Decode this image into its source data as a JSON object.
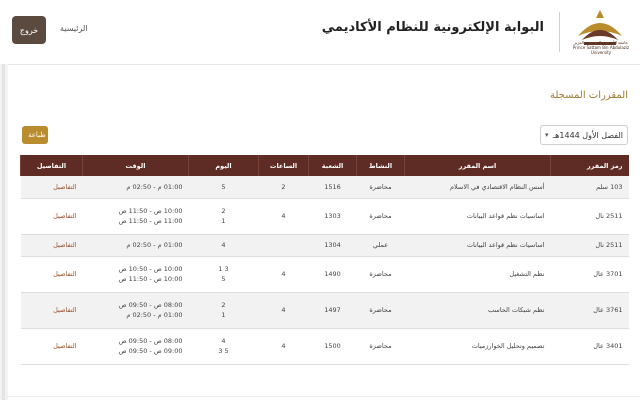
{
  "header": {
    "portal_title": "البوابة الإلكترونية للنظام الأكاديمي",
    "university_name_ar": "جامعة الأمير سطام بن عبدالعزيز",
    "university_name_en": "Prince Sattam Bin Abdulaziz University",
    "home_label": "الرئيسية",
    "logout_label": "خروج"
  },
  "page": {
    "section_title": "المقررات المسجلة",
    "semester_value": "الفصل الأول 1444هـ",
    "print_label": "طباعة"
  },
  "colors": {
    "header_bar": "#5e2c24",
    "accent_gold": "#b98d2e",
    "logout_button": "#5a4a40",
    "details_link": "#a0522d"
  },
  "table": {
    "headers": {
      "code": "رمز المقرر",
      "name": "اسم المقرر",
      "activity": "النشاط",
      "section": "الشعبة",
      "hours": "الساعات",
      "day": "اليوم",
      "time": "الوقت",
      "details": "التفاصيل"
    },
    "rows": [
      {
        "code": "103 سلم",
        "name": "أسس النظام الاقتصادي في الاسلام",
        "activity": "محاضرة",
        "section": "1516",
        "hours": "2",
        "day1": "5",
        "time1": "01:00 م - 02:50 م",
        "day2": "",
        "time2": "",
        "details": "التفاصيل"
      },
      {
        "code": "2511 نال",
        "name": "اساسيات نظم قواعد البيانات",
        "activity": "محاضرة",
        "section": "1303",
        "hours": "4",
        "day1": "2",
        "time1": "10:00 ص - 11:50 ص",
        "day2": "1",
        "time2": "11:00 ص - 11:50 ص",
        "details": "التفاصيل"
      },
      {
        "code": "2511 نال",
        "name": "اساسيات نظم قواعد البيانات",
        "activity": "عملي",
        "section": "1304",
        "hours": "",
        "day1": "4",
        "time1": "01:00 م - 02:50 م",
        "day2": "",
        "time2": "",
        "details": "التفاصيل"
      },
      {
        "code": "3701 عال",
        "name": "نظم التشغيل",
        "activity": "محاضرة",
        "section": "1490",
        "hours": "4",
        "day1": "3 1",
        "time1": "10:00 ص - 10:50 ص",
        "day2": "5",
        "time2": "10:00 ص - 11:50 ص",
        "details": "التفاصيل"
      },
      {
        "code": "3761 عال",
        "name": "نظم شبكات الحاسب",
        "activity": "محاضرة",
        "section": "1497",
        "hours": "4",
        "day1": "2",
        "time1": "08:00 ص - 09:50 ص",
        "day2": "1",
        "time2": "01:00 م - 02:50 م",
        "details": "التفاصيل"
      },
      {
        "code": "3401 عال",
        "name": "تصميم وتحليل الخوارزميات",
        "activity": "محاضرة",
        "section": "1500",
        "hours": "4",
        "day1": "4",
        "time1": "08:00 ص - 09:50 ص",
        "day2": "5 3",
        "time2": "09:00 ص - 09:50 ص",
        "details": "التفاصيل"
      }
    ]
  }
}
